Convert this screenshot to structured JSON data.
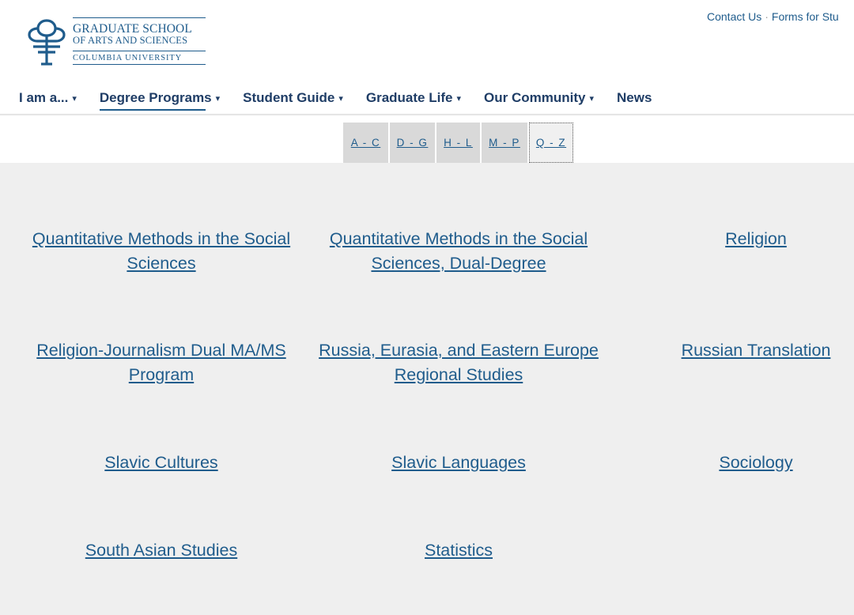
{
  "header": {
    "logo": {
      "line1": "GRADUATE SCHOOL",
      "line2": "OF ARTS AND SCIENCES",
      "line3": "COLUMBIA UNIVERSITY"
    },
    "utility": {
      "contact": "Contact Us",
      "separator": "·",
      "forms": "Forms for Stu"
    },
    "nav": [
      {
        "label": "I am a...",
        "caret": "▾"
      },
      {
        "label": "Degree Programs",
        "caret": "▾"
      },
      {
        "label": "Student Guide",
        "caret": "▾"
      },
      {
        "label": "Graduate Life",
        "caret": "▾"
      },
      {
        "label": "Our Community",
        "caret": "▾"
      },
      {
        "label": "News"
      }
    ]
  },
  "alpha_tabs": [
    "A - C",
    "D - G",
    "H - L",
    "M - P",
    "Q - Z"
  ],
  "programs": [
    {
      "label": "Quantitative Methods in the Social Sciences"
    },
    {
      "label": "Quantitative Methods in the Social Sciences, Dual-Degree"
    },
    {
      "label": "Religion"
    },
    {
      "label": "Religion-Journalism Dual MA/MS Program"
    },
    {
      "label": "Russia, Eurasia, and Eastern Europe Regional Studies"
    },
    {
      "label": "Russian Translation"
    },
    {
      "label": "Slavic Cultures"
    },
    {
      "label": "Slavic Languages"
    },
    {
      "label": "Sociology"
    },
    {
      "label": "South Asian Studies"
    },
    {
      "label": "Statistics"
    }
  ],
  "colors": {
    "link": "#1f5c8c",
    "nav": "#1f3d66",
    "content_bg": "#efefef",
    "tab_bg": "#d9d9d9"
  }
}
